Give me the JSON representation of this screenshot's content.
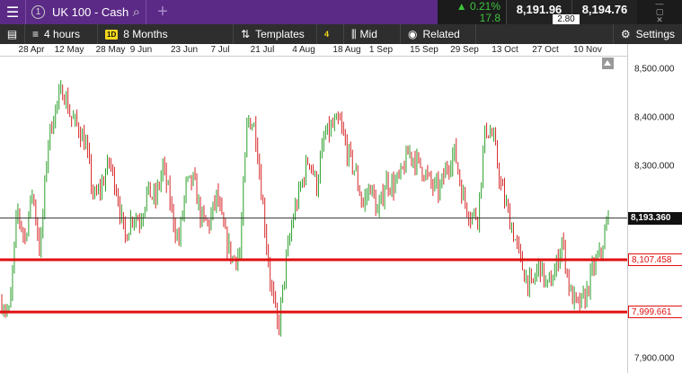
{
  "topbar": {
    "menu_icon": "hamburger-icon",
    "instrument_number": "1",
    "instrument": "UK 100 - Cash",
    "search_icon": "magnifier-icon",
    "add_icon": "plus-icon"
  },
  "quote": {
    "change_pct": "▲ 0.21%",
    "change_pts": "17.8",
    "bid": "8,191.96",
    "ask": "8,194.76",
    "spread": "2.80",
    "window_icons": [
      "minimize-icon",
      "maximize-icon",
      "close-icon"
    ]
  },
  "toolbar": {
    "interval": "4 hours",
    "timeframe_badge": "1D",
    "timeframe": "8 Months",
    "templates": "Templates",
    "indicator_count": "4",
    "price_type": "Mid",
    "related": "Related",
    "settings": "Settings"
  },
  "chart_data": {
    "type": "bar",
    "subtype": "ohlc",
    "x_ticks": [
      "28 Apr",
      "12 May",
      "28 May",
      "9 Jun",
      "23 Jun",
      "7 Jul",
      "21 Jul",
      "4 Aug",
      "18 Aug",
      "1 Sep",
      "15 Sep",
      "29 Sep",
      "13 Oct",
      "27 Oct",
      "10 Nov"
    ],
    "y_ticks": [
      "8,500.000",
      "8,400.000",
      "8,300.000",
      "7,900.000"
    ],
    "ylim": [
      7880,
      8530
    ],
    "current_price": 8193.36,
    "current_price_label": "8,193.360",
    "horizontal_lines": [
      {
        "value": 8107.458,
        "label": "8,107.458",
        "color": "#e01010"
      },
      {
        "value": 7999.661,
        "label": "7,999.661",
        "color": "#e01010"
      }
    ],
    "up_color": "#2ca02c",
    "down_color": "#d62728",
    "close_path": [
      8020,
      7995,
      8210,
      8150,
      8250,
      8120,
      8350,
      8420,
      8460,
      8400,
      8380,
      8340,
      8230,
      8260,
      8310,
      8250,
      8150,
      8200,
      8190,
      8250,
      8230,
      8300,
      8220,
      8140,
      8260,
      8270,
      8190,
      8180,
      8240,
      8160,
      8110,
      8120,
      8400,
      8380,
      8220,
      8060,
      7960,
      8100,
      8200,
      8260,
      8320,
      8260,
      8360,
      8380,
      8390,
      8330,
      8290,
      8220,
      8260,
      8200,
      8270,
      8260,
      8280,
      8330,
      8310,
      8290,
      8260,
      8250,
      8300,
      8330,
      8240,
      8200,
      8200,
      8380,
      8360,
      8260,
      8200,
      8140,
      8080,
      8050,
      8100,
      8050,
      8080,
      8150,
      8040,
      8010,
      8030,
      8090,
      8120,
      8193
    ]
  }
}
